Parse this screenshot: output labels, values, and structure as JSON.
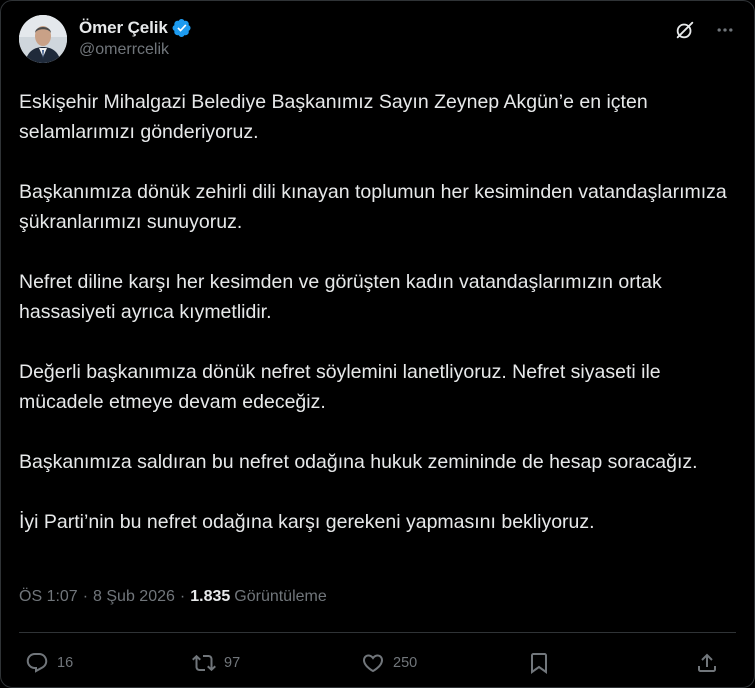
{
  "author": {
    "name": "Ömer Çelik",
    "handle": "@omerrcelik",
    "verified": true
  },
  "header_icons": [
    "grok-icon",
    "more-icon"
  ],
  "tweet": {
    "paragraphs": [
      "Eskişehir Mihalgazi Belediye Başkanımız Sayın Zeynep Akgün’e en içten selamlarımızı gönderiyoruz.",
      "Başkanımıza dönük zehirli dili kınayan toplumun her kesiminden vatandaşlarımıza şükranlarımızı sunuyoruz.",
      "Nefret diline karşı her kesimden ve görüşten kadın vatandaşlarımızın ortak hassasiyeti ayrıca kıymetlidir.",
      "Değerli başkanımıza dönük nefret söylemini lanetliyoruz. Nefret siyaseti ile mücadele etmeye devam edeceğiz.",
      "Başkanımıza saldıran bu nefret odağına hukuk zemininde de hesap soracağız.",
      "İyi Parti’nin bu nefret odağına karşı gerekeni yapmasını bekliyoruz."
    ]
  },
  "meta": {
    "time": "ÖS 1:07",
    "separator": "·",
    "date": "8 Şub 2026",
    "views_count": "1.835",
    "views_label": "Görüntüleme"
  },
  "actions": {
    "replies": "16",
    "reposts": "97",
    "likes": "250"
  },
  "colors": {
    "background": "#000000",
    "text": "#e7e9ea",
    "secondary": "#71767b",
    "verified": "#1d9bf0",
    "border": "#2f3336"
  }
}
